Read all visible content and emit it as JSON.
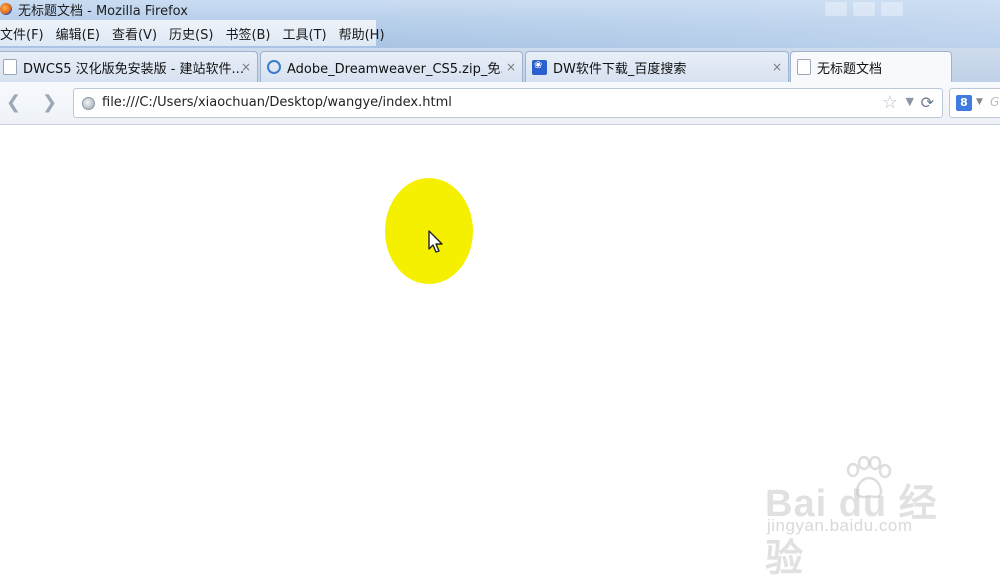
{
  "window": {
    "title": "无标题文档 - Mozilla Firefox"
  },
  "menu": {
    "items": [
      "文件(F)",
      "编辑(E)",
      "查看(V)",
      "历史(S)",
      "书签(B)",
      "工具(T)",
      "帮助(H)"
    ]
  },
  "tabs": [
    {
      "title": "DWCS5 汉化版免安装版 - 建站软件...",
      "close": "×",
      "icon": "blank-page-icon"
    },
    {
      "title": "Adobe_Dreamweaver_CS5.zip_免...",
      "close": "×",
      "icon": "link-icon"
    },
    {
      "title": "DW软件下载_百度搜索",
      "close": "×",
      "icon": "baidu-paw-icon"
    },
    {
      "title": "无标题文档",
      "icon": "blank-page-icon",
      "active": true
    }
  ],
  "navbar": {
    "url": "file:///C:/Users/xiaochuan/Desktop/wangye/index.html",
    "search_engine_letter": "8",
    "search_placeholder": "G"
  },
  "watermark": {
    "brand": "Bai du 经验",
    "domain": "jingyan.baidu.com"
  },
  "colors": {
    "highlight": "#f5f000",
    "titlebar": "#b7cfea"
  }
}
